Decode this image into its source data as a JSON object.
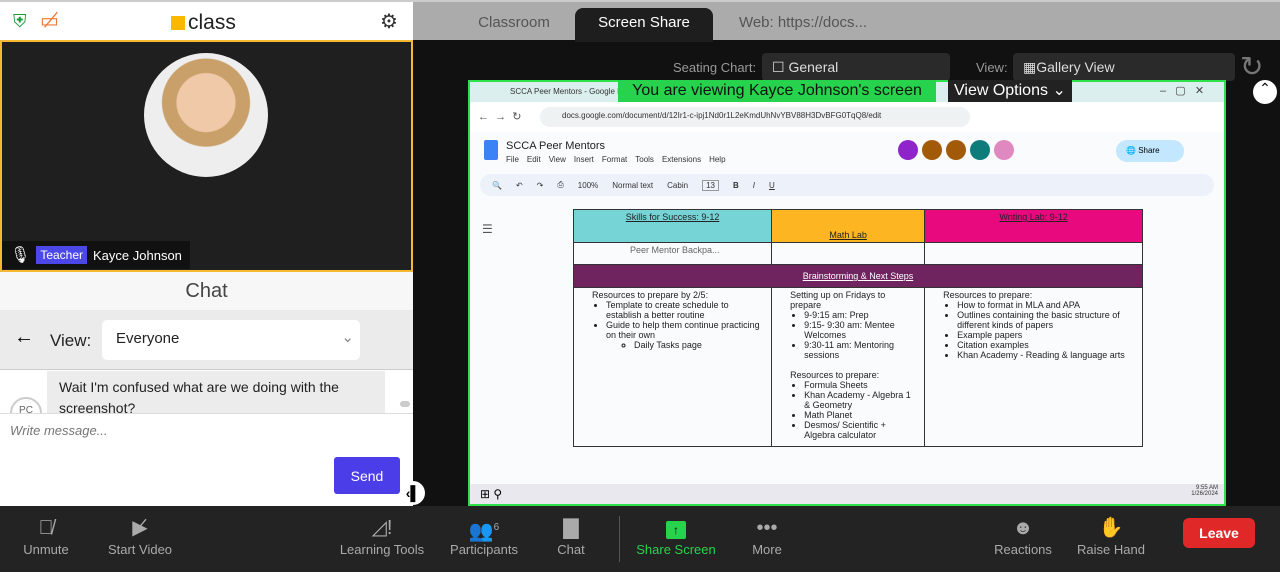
{
  "app": {
    "logo_text": "class",
    "settings_icon": "gear-icon"
  },
  "video": {
    "role_badge": "Teacher",
    "name": "Kayce Johnson"
  },
  "chat": {
    "title": "Chat",
    "view_label": "View:",
    "view_value": "Everyone",
    "message": "Wait I'm confused what are we doing with the screenshot?",
    "avatar_initials": "PC",
    "placeholder": "Write message...",
    "send": "Send"
  },
  "tabs": [
    "Classroom",
    "Screen Share",
    "Web: https://docs..."
  ],
  "controls": {
    "seating_label": "Seating Chart:",
    "seating_value": "General",
    "view_label": "View:",
    "view_value": "Gallery View"
  },
  "share": {
    "banner": "You are viewing Kayce Johnson's screen",
    "view_options": "View Options"
  },
  "browser": {
    "tab_title": "SCCA Peer Mentors - Google D",
    "url": "docs.google.com/document/d/12Ir1-c-ipj1Nd0r1L2eKmdUhNvYBV88H3DvBFG0TqQ8/edit"
  },
  "doc": {
    "title": "SCCA Peer Mentors",
    "menus": [
      "File",
      "Edit",
      "View",
      "Insert",
      "Format",
      "Tools",
      "Extensions",
      "Help"
    ],
    "share": "Share",
    "zoom": "100%",
    "style": "Normal text",
    "font": "Cabin",
    "size": "13",
    "headers": [
      "Skills for Success: 9-12",
      "Math Lab",
      "Writing Lab: 9-12"
    ],
    "chip": "Peer Mentor Backpa...",
    "band": "Brainstorming & Next Steps",
    "col1": {
      "intro": "Resources to prepare by 2/5:",
      "items": [
        "Template to create schedule to establish a better routine",
        "Guide to help them continue practicing on their own"
      ],
      "sub": "Daily Tasks page"
    },
    "col2": {
      "intro": "Setting up on Fridays to prepare",
      "items": [
        "9-9:15 am: Prep",
        "9:15- 9:30 am: Mentee Welcomes",
        "9:30-11 am: Mentoring sessions"
      ],
      "intro2": "Resources to prepare:",
      "items2": [
        "Formula Sheets",
        "Khan Academy - Algebra 1 & Geometry",
        "Math Planet",
        "Desmos/ Scientific + Algebra calculator"
      ]
    },
    "col3": {
      "intro": "Resources to prepare:",
      "items": [
        "How to format in MLA and APA",
        "Outlines containing the basic structure of different kinds of papers",
        "Example papers",
        "Citation examples",
        "Khan Academy - Reading & language arts"
      ]
    }
  },
  "taskbar": {
    "time": "9:55 AM",
    "date": "1/26/2024"
  },
  "toolbar": {
    "unmute": "Unmute",
    "video": "Start Video",
    "learning": "Learning Tools",
    "participants": "Participants",
    "participants_count": "6",
    "chat": "Chat",
    "share": "Share Screen",
    "more": "More",
    "reactions": "Reactions",
    "raise": "Raise Hand",
    "leave": "Leave"
  },
  "colors": {
    "accent": "#4b3de8",
    "share_green": "#27d34c",
    "leave": "#e02828",
    "teal": "#76d3d6",
    "orange": "#fdb622",
    "pink": "#e8097f",
    "purple": "#6f2460"
  }
}
